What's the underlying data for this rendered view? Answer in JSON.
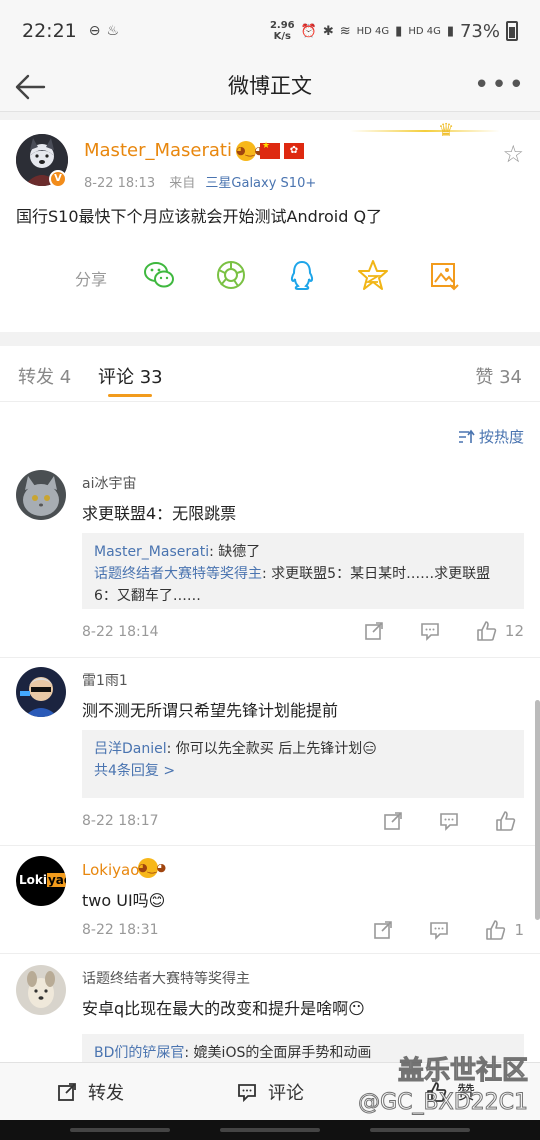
{
  "status_bar": {
    "time": "22:21",
    "net_speed_value": "2.96",
    "net_speed_unit": "K/s",
    "signal1": "HD 4G",
    "signal2": "HD 4G",
    "battery": "73%"
  },
  "header": {
    "title": "微博正文"
  },
  "post": {
    "username": "Master_Maserati",
    "time": "8-22 18:13",
    "source_prefix": "来自",
    "source": "三星Galaxy S10+",
    "text": "国行S10最快下个月应该就会开始测试Android Q了",
    "share_label": "分享",
    "share_icons": [
      "wechat-icon",
      "moments-icon",
      "qq-icon",
      "qzone-icon",
      "save-image-icon"
    ],
    "verified_badge": "V"
  },
  "tabs": [
    {
      "label": "转发 4"
    },
    {
      "label": "评论 33"
    },
    {
      "label": "赞 34"
    }
  ],
  "sort_label": "按热度",
  "comments": [
    {
      "name": "ai冰宇宙",
      "text": "求更联盟4：无限跳票",
      "replies": [
        {
          "name": "Master_Maserati",
          "text": ": 缺德了"
        },
        {
          "name": "话题终结者大赛特等奖得主",
          "text": ": 求更联盟5：某日某时……求更联盟6：又翻车了……"
        }
      ],
      "time": "8-22 18:14",
      "likes": "12"
    },
    {
      "name": "雷1雨1",
      "text": "测不测无所谓只希望先锋计划能提前",
      "replies": [
        {
          "name": "吕洋Daniel",
          "text": ": 你可以先全款买 后上先锋计划😑"
        }
      ],
      "more_replies": "共4条回复 >",
      "time": "8-22 18:17",
      "likes": ""
    },
    {
      "name": "Lokiyao",
      "text": "two UI吗😊",
      "time": "8-22 18:31",
      "likes": "1",
      "avatar_text_1": "Loki",
      "avatar_text_2": "yao"
    },
    {
      "name": "话题终结者大赛特等奖得主",
      "text": "安卓q比现在最大的改变和提升是啥啊😶",
      "replies": [
        {
          "name": "BD们的铲屎官",
          "text": ": 媲美iOS的全面屏手势和动画"
        }
      ]
    }
  ],
  "bottom_bar": {
    "repost": "转发",
    "comment": "评论",
    "like": "赞"
  },
  "watermark": {
    "line1": "盖乐世社区",
    "line2": "@GC_BXD22C1"
  },
  "colors": {
    "accent": "#f29b1c",
    "link": "#4a74b0",
    "vip_name": "#e8870e"
  }
}
